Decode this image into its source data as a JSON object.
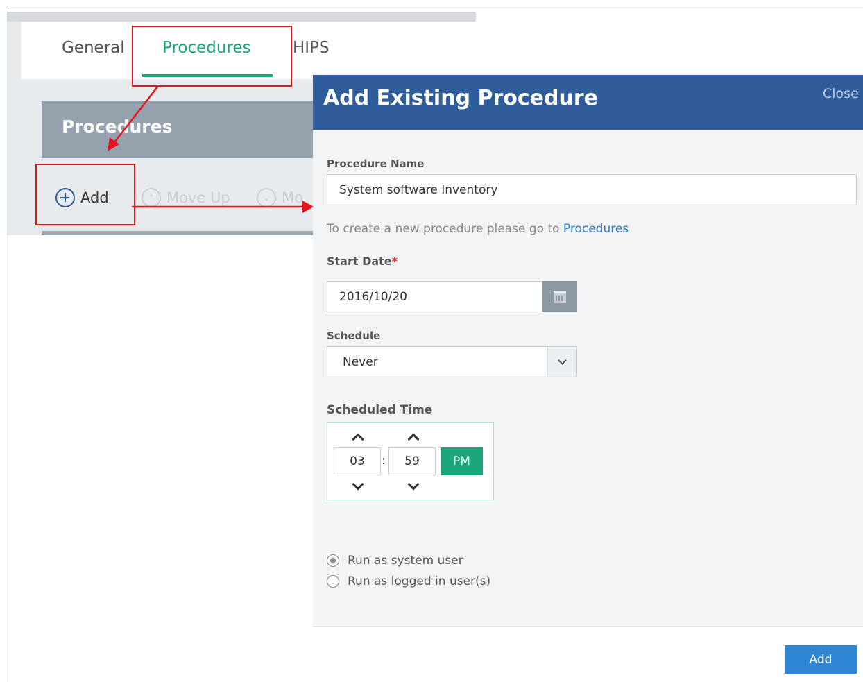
{
  "tabs": [
    {
      "label": "General"
    },
    {
      "label": "Procedures"
    },
    {
      "label": "HIPS"
    }
  ],
  "procedures_panel": {
    "title": "Procedures",
    "toolbar": {
      "add_label": "Add",
      "move_up_label": "Move Up",
      "move_down_label": "Mo"
    }
  },
  "modal": {
    "title": "Add Existing Procedure",
    "close_label": "Close",
    "procedure_name": {
      "label": "Procedure Name",
      "value": "System software Inventory"
    },
    "hint": {
      "text": "To create a new procedure please go to ",
      "link": "Procedures"
    },
    "start_date": {
      "label": "Start Date",
      "required_mark": "*",
      "value": "2016/10/20"
    },
    "schedule": {
      "label": "Schedule",
      "value": "Never"
    },
    "scheduled_time": {
      "label": "Scheduled Time",
      "hour": "03",
      "separator": ":",
      "minute": "59",
      "meridiem": "PM"
    },
    "run_as": [
      {
        "label": "Run as system user",
        "selected": true
      },
      {
        "label": "Run as logged in user(s)",
        "selected": false
      }
    ],
    "submit_label": "Add"
  },
  "colors": {
    "accent_green": "#1aa57c",
    "modal_header": "#2f5d9b",
    "primary_button": "#2e86d4",
    "annotation_red": "#e5141a"
  }
}
